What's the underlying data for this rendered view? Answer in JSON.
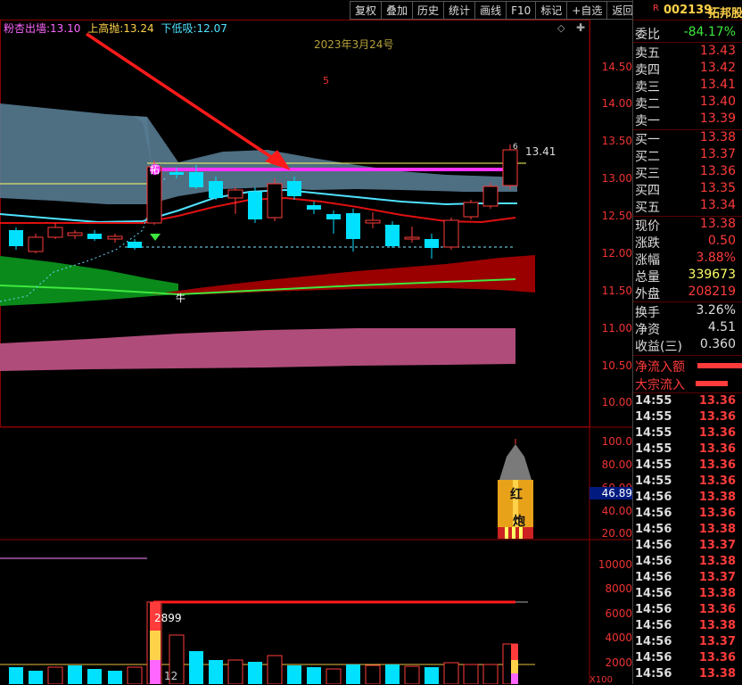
{
  "toolbar": {
    "buttons": [
      "复权",
      "叠加",
      "历史",
      "统计",
      "画线",
      "F10",
      "标记",
      "+自选",
      "返回"
    ]
  },
  "legend": {
    "item1_label": "粉杏出墙:",
    "item1_value": "13.10",
    "item2_label": "上高抛:",
    "item2_value": "13.24",
    "item3_label": "下低吸:",
    "item3_value": "12.07"
  },
  "chart": {
    "date_label": "2023年3月24号",
    "small_marker": "5",
    "price_tag": "13.41",
    "candle_marker_top": "6",
    "marker_tuo": "拓",
    "marker_niu": "牛",
    "price_axis": [
      "14.50",
      "14.00",
      "13.50",
      "13.00",
      "12.50",
      "12.00",
      "11.50",
      "11.00",
      "10.50",
      "10.00"
    ],
    "indicator_axis": [
      "100.0",
      "80.00",
      "60.00",
      "40.00",
      "20.00"
    ],
    "indicator_value": "46.89",
    "rocket_text_1": "红",
    "rocket_text_2": "炮",
    "volume_axis": [
      "10000",
      "8000",
      "6000",
      "4000",
      "2000"
    ],
    "volume_peak": "2899",
    "volume_min_label": "12",
    "volume_unit": "X100"
  },
  "colors": {
    "up": "#ff3b3b",
    "down": "#00e0ff",
    "magenta": "#ff33ff",
    "green": "#22b14c",
    "yellow": "#ffff66",
    "band_blue": "#5a7f95",
    "band_red": "#a00000",
    "band_pink": "#b04c7a"
  },
  "quote": {
    "code": "002139",
    "name": "拓邦股份",
    "r_badge": "R",
    "webi_label": "委比",
    "webi_value": "-84.17%",
    "sell": [
      {
        "label": "卖五",
        "price": "13.43"
      },
      {
        "label": "卖四",
        "price": "13.42"
      },
      {
        "label": "卖三",
        "price": "13.41"
      },
      {
        "label": "卖二",
        "price": "13.40"
      },
      {
        "label": "卖一",
        "price": "13.39"
      }
    ],
    "buy": [
      {
        "label": "买一",
        "price": "13.38"
      },
      {
        "label": "买二",
        "price": "13.37"
      },
      {
        "label": "买三",
        "price": "13.36"
      },
      {
        "label": "买四",
        "price": "13.35"
      },
      {
        "label": "买五",
        "price": "13.34"
      }
    ],
    "stats": [
      {
        "label": "现价",
        "value": "13.38"
      },
      {
        "label": "涨跌",
        "value": "0.50"
      },
      {
        "label": "涨幅",
        "value": "3.88%"
      },
      {
        "label": "总量",
        "value": "339673"
      },
      {
        "label": "外盘",
        "value": "208219"
      }
    ],
    "stats2": [
      {
        "label": "换手",
        "value": "3.26%"
      },
      {
        "label": "净资",
        "value": "4.51"
      },
      {
        "label": "收益(三)",
        "value": "0.360"
      }
    ],
    "flow": [
      {
        "label": "净流入额"
      },
      {
        "label": "大宗流入"
      }
    ],
    "ticks": [
      {
        "time": "14:55",
        "price": "13.36"
      },
      {
        "time": "14:55",
        "price": "13.36"
      },
      {
        "time": "14:55",
        "price": "13.36"
      },
      {
        "time": "14:55",
        "price": "13.36"
      },
      {
        "time": "14:55",
        "price": "13.36"
      },
      {
        "time": "14:55",
        "price": "13.36"
      },
      {
        "time": "14:56",
        "price": "13.38"
      },
      {
        "time": "14:56",
        "price": "13.36"
      },
      {
        "time": "14:56",
        "price": "13.38"
      },
      {
        "time": "14:56",
        "price": "13.37"
      },
      {
        "time": "14:56",
        "price": "13.38"
      },
      {
        "time": "14:56",
        "price": "13.37"
      },
      {
        "time": "14:56",
        "price": "13.38"
      },
      {
        "time": "14:56",
        "price": "13.36"
      },
      {
        "time": "14:56",
        "price": "13.38"
      },
      {
        "time": "14:56",
        "price": "13.37"
      },
      {
        "time": "14:56",
        "price": "13.36"
      },
      {
        "time": "14:56",
        "price": "13.38"
      }
    ]
  }
}
